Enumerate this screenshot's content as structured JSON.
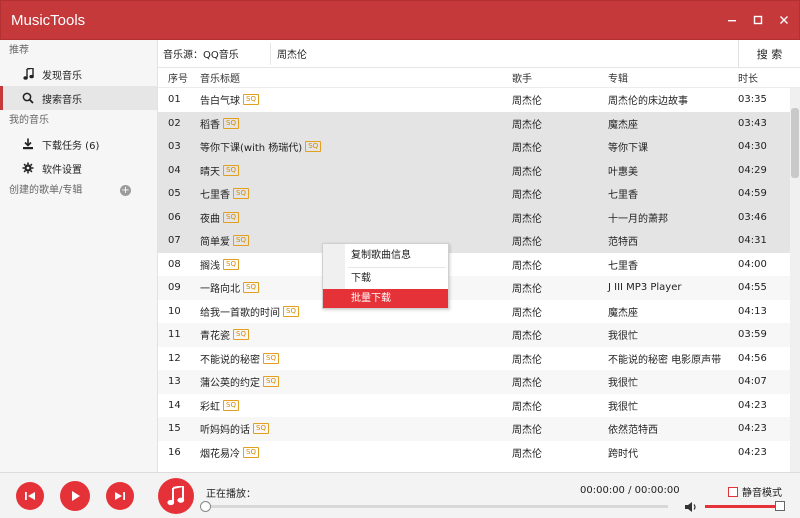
{
  "app": {
    "title": "MusicTools"
  },
  "window": {
    "minimize": "‒",
    "maximize": "▢",
    "close": "✕"
  },
  "sidebar": {
    "sections": [
      {
        "header": "推荐",
        "items": [
          {
            "label": "发现音乐",
            "icon": "music-note-icon"
          },
          {
            "label": "搜索音乐",
            "icon": "search-icon",
            "active": true
          }
        ]
      },
      {
        "header": "我的音乐",
        "items": [
          {
            "label": "下载任务 (6)",
            "icon": "download-icon"
          },
          {
            "label": "软件设置",
            "icon": "gear-icon"
          }
        ]
      },
      {
        "header": "创建的歌单/专辑",
        "items": [],
        "add": "+"
      }
    ]
  },
  "search": {
    "source_label": "音乐源：QQ音乐",
    "query": "周杰伦",
    "button_label": "搜 索"
  },
  "table": {
    "columns": [
      "序号",
      "音乐标题",
      "歌手",
      "专辑",
      "时长"
    ],
    "badge": "SQ",
    "rows": [
      {
        "no": "01",
        "title": "告白气球",
        "artist": "周杰伦",
        "album": "周杰伦的床边故事",
        "duration": "03:35"
      },
      {
        "no": "02",
        "title": "稻香",
        "artist": "周杰伦",
        "album": "魔杰座",
        "duration": "03:43"
      },
      {
        "no": "03",
        "title": "等你下课(with 杨瑞代)",
        "artist": "周杰伦",
        "album": "等你下课",
        "duration": "04:30"
      },
      {
        "no": "04",
        "title": "晴天",
        "artist": "周杰伦",
        "album": "叶惠美",
        "duration": "04:29"
      },
      {
        "no": "05",
        "title": "七里香",
        "artist": "周杰伦",
        "album": "七里香",
        "duration": "04:59"
      },
      {
        "no": "06",
        "title": "夜曲",
        "artist": "周杰伦",
        "album": "十一月的萧邦",
        "duration": "03:46"
      },
      {
        "no": "07",
        "title": "简单爱",
        "artist": "周杰伦",
        "album": "范特西",
        "duration": "04:31"
      },
      {
        "no": "08",
        "title": "搁浅",
        "artist": "周杰伦",
        "album": "七里香",
        "duration": "04:00"
      },
      {
        "no": "09",
        "title": "一路向北",
        "artist": "周杰伦",
        "album": "J III MP3 Player",
        "duration": "04:55"
      },
      {
        "no": "10",
        "title": "给我一首歌的时间",
        "artist": "周杰伦",
        "album": "魔杰座",
        "duration": "04:13"
      },
      {
        "no": "11",
        "title": "青花瓷",
        "artist": "周杰伦",
        "album": "我很忙",
        "duration": "03:59"
      },
      {
        "no": "12",
        "title": "不能说的秘密",
        "artist": "周杰伦",
        "album": "不能说的秘密 电影原声带",
        "duration": "04:56"
      },
      {
        "no": "13",
        "title": "蒲公英的约定",
        "artist": "周杰伦",
        "album": "我很忙",
        "duration": "04:07"
      },
      {
        "no": "14",
        "title": "彩虹",
        "artist": "周杰伦",
        "album": "我很忙",
        "duration": "04:23"
      },
      {
        "no": "15",
        "title": "听妈妈的话",
        "artist": "周杰伦",
        "album": "依然范特西",
        "duration": "04:23"
      },
      {
        "no": "16",
        "title": "烟花易冷",
        "artist": "周杰伦",
        "album": "跨时代",
        "duration": "04:23"
      }
    ]
  },
  "context_menu": {
    "items": [
      "复制歌曲信息",
      "下载",
      "批量下载"
    ],
    "highlighted": "批量下载"
  },
  "player": {
    "now_playing_label": "正在播放：",
    "time": "00:00:00 / 00:00:00",
    "mute_label": "静音模式",
    "progress": 0,
    "volume": 1.0
  },
  "colors": {
    "accent": "#c5393b",
    "button_red": "#e53238",
    "badge": "#e3a020",
    "selected_row": "#e4e4e4"
  }
}
